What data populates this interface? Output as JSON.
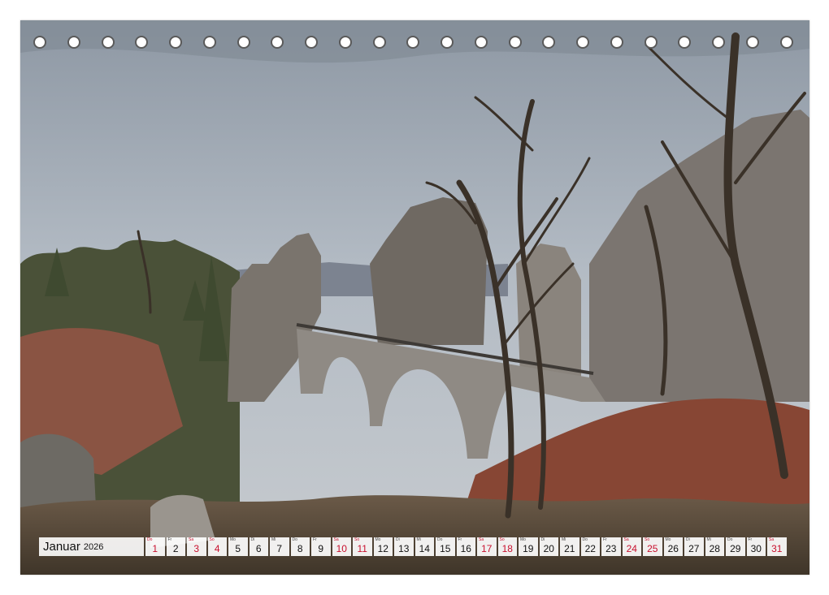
{
  "calendar": {
    "month": "Januar",
    "year": "2026",
    "days": [
      {
        "wd": "Do",
        "num": "1",
        "red": true
      },
      {
        "wd": "Fr",
        "num": "2",
        "red": false
      },
      {
        "wd": "Sa",
        "num": "3",
        "red": true
      },
      {
        "wd": "So",
        "num": "4",
        "red": true
      },
      {
        "wd": "Mo",
        "num": "5",
        "red": false
      },
      {
        "wd": "Di",
        "num": "6",
        "red": false
      },
      {
        "wd": "Mi",
        "num": "7",
        "red": false
      },
      {
        "wd": "Do",
        "num": "8",
        "red": false
      },
      {
        "wd": "Fr",
        "num": "9",
        "red": false
      },
      {
        "wd": "Sa",
        "num": "10",
        "red": true
      },
      {
        "wd": "So",
        "num": "11",
        "red": true
      },
      {
        "wd": "Mo",
        "num": "12",
        "red": false
      },
      {
        "wd": "Di",
        "num": "13",
        "red": false
      },
      {
        "wd": "Mi",
        "num": "14",
        "red": false
      },
      {
        "wd": "Do",
        "num": "15",
        "red": false
      },
      {
        "wd": "Fr",
        "num": "16",
        "red": false
      },
      {
        "wd": "Sa",
        "num": "17",
        "red": true
      },
      {
        "wd": "So",
        "num": "18",
        "red": true
      },
      {
        "wd": "Mo",
        "num": "19",
        "red": false
      },
      {
        "wd": "Di",
        "num": "20",
        "red": false
      },
      {
        "wd": "Mi",
        "num": "21",
        "red": false
      },
      {
        "wd": "Do",
        "num": "22",
        "red": false
      },
      {
        "wd": "Fr",
        "num": "23",
        "red": false
      },
      {
        "wd": "Sa",
        "num": "24",
        "red": true
      },
      {
        "wd": "So",
        "num": "25",
        "red": true
      },
      {
        "wd": "Mo",
        "num": "26",
        "red": false
      },
      {
        "wd": "Di",
        "num": "27",
        "red": false
      },
      {
        "wd": "Mi",
        "num": "28",
        "red": false
      },
      {
        "wd": "Do",
        "num": "29",
        "red": false
      },
      {
        "wd": "Fr",
        "num": "30",
        "red": false
      },
      {
        "wd": "Sa",
        "num": "31",
        "red": true
      }
    ]
  },
  "binding": {
    "hole_count": 23
  },
  "colors": {
    "weekend": "#c8102e",
    "hole_border": "#5a5a5a",
    "sky": "#aeb6c0",
    "sandstone": "#7d766e",
    "foliage_red": "#8a4a38"
  }
}
